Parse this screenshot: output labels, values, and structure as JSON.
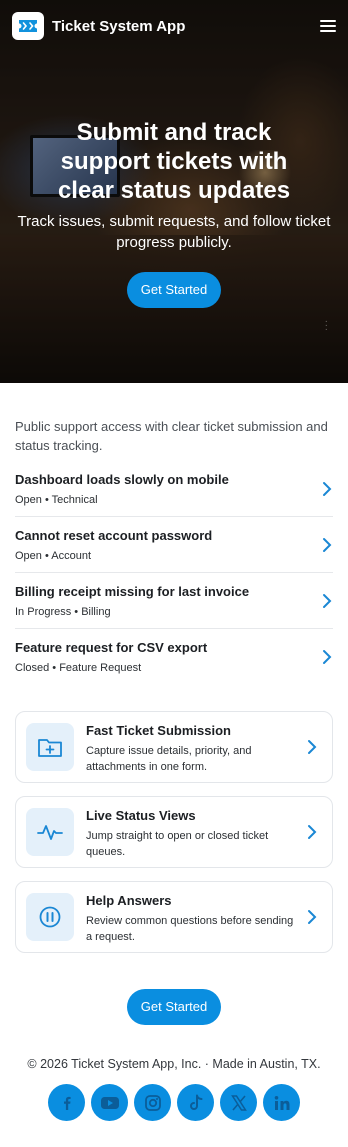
{
  "header": {
    "app_name": "Ticket System App",
    "logo_icon": "ticket-icon",
    "menu_icon": "hamburger-menu-icon"
  },
  "hero": {
    "title": "Submit and track support tickets with clear status updates",
    "subtitle": "Track issues, submit requests, and follow ticket progress publicly.",
    "cta_label": "Get Started"
  },
  "intro": "Public support access with clear ticket submission and status tracking.",
  "tickets": [
    {
      "title": "Dashboard loads slowly on mobile",
      "meta": "Open • Technical"
    },
    {
      "title": "Cannot reset account password",
      "meta": "Open • Account"
    },
    {
      "title": "Billing receipt missing for last invoice",
      "meta": "In Progress • Billing"
    },
    {
      "title": "Feature request for CSV export",
      "meta": "Closed • Feature Request"
    }
  ],
  "features": [
    {
      "title": "Fast Ticket Submission",
      "desc": "Capture issue details, priority, and attachments in one form.",
      "icon": "folder-plus-icon"
    },
    {
      "title": "Live Status Views",
      "desc": "Jump straight to open or closed ticket queues.",
      "icon": "activity-pulse-icon"
    },
    {
      "title": "Help Answers",
      "desc": "Review common questions before sending a request.",
      "icon": "pause-circle-icon"
    }
  ],
  "bottom_cta_label": "Get Started",
  "footer": {
    "copyright": "© 2026 Ticket System App, Inc. · Made in Austin, TX."
  },
  "socials": [
    "facebook-icon",
    "youtube-icon",
    "instagram-icon",
    "tiktok-icon",
    "x-icon",
    "linkedin-icon"
  ],
  "colors": {
    "accent": "#0a8ee0",
    "icon_bg": "#e4f0fa",
    "chevron": "#1a87d4"
  }
}
